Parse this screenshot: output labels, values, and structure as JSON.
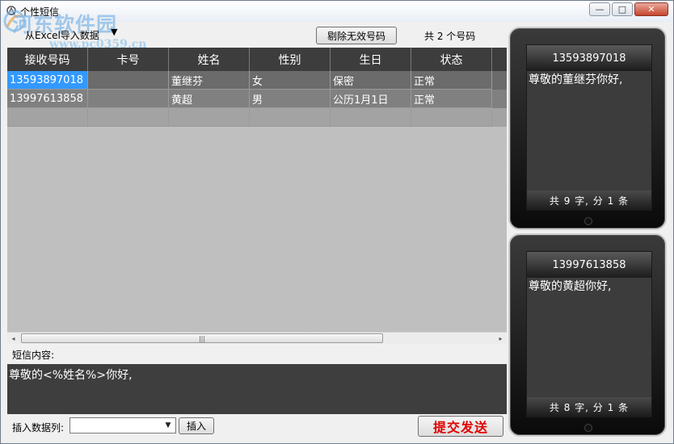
{
  "window": {
    "title": "个性短信",
    "watermark": "河东软件园",
    "watermark_url": "www.pc0359.cn",
    "controls": {
      "minimize": "—",
      "maximize": "□",
      "close": "✕"
    }
  },
  "toolbar": {
    "import_label": "从Excel导入数据",
    "import_arrow": "▼",
    "remove_button": "剔除无效号码",
    "count_label": "共 2 个号码"
  },
  "grid": {
    "columns": [
      "接收号码",
      "卡号",
      "姓名",
      "性别",
      "生日",
      "状态"
    ],
    "rows": [
      [
        "13593897018",
        "",
        "董继芬",
        "女",
        "保密",
        "正常"
      ],
      [
        "13997613858",
        "",
        "黄超",
        "男",
        "公历1月1日",
        "正常"
      ],
      [
        "",
        "",
        "",
        "",
        "",
        ""
      ]
    ],
    "scroll_left": "◂",
    "scroll_right": "▸",
    "scroll_grip": "|||"
  },
  "message": {
    "label": "短信内容:",
    "content": "尊敬的<%姓名%>你好,"
  },
  "insert": {
    "label": "插入数据列:",
    "select_value": "",
    "insert_button": "插入",
    "submit_button": "提交发送"
  },
  "previews": [
    {
      "number": "13593897018",
      "text": "尊敬的董继芬你好,",
      "footer": "共 9 字, 分 1 条"
    },
    {
      "number": "13997613858",
      "text": "尊敬的黄超你好,",
      "footer": "共 8 字, 分 1 条"
    }
  ],
  "colors": {
    "selection": "#3399ff",
    "header_bg": "#3d3d3d",
    "submit_text": "#e00000"
  }
}
